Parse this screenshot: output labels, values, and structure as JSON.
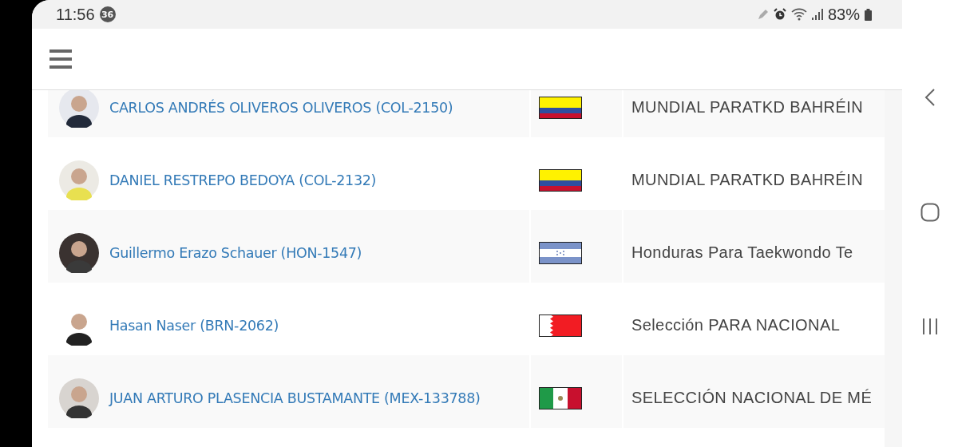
{
  "status_bar": {
    "time": "11:56",
    "notification_count": "36",
    "battery": "83%"
  },
  "athletes": [
    {
      "name": "CARLOS ANDRÉS OLIVEROS OLIVEROS (COL-2150)",
      "flag": {
        "kind": "colombia"
      },
      "team": "MUNDIAL PARATKD BAHRÉIN"
    },
    {
      "name": "DANIEL RESTREPO BEDOYA (COL-2132)",
      "flag": {
        "kind": "colombia"
      },
      "team": "MUNDIAL PARATKD BAHRÉIN"
    },
    {
      "name": "Guillermo Erazo Schauer (HON-1547)",
      "flag": {
        "kind": "honduras"
      },
      "team": "Honduras Para Taekwondo Te"
    },
    {
      "name": "Hasan Naser (BRN-2062)",
      "flag": {
        "kind": "bahrain"
      },
      "team": "Selección PARA NACIONAL"
    },
    {
      "name": "JUAN ARTURO PLASENCIA BUSTAMANTE (MEX-133788)",
      "flag": {
        "kind": "mexico"
      },
      "team": "SELECCIÓN NACIONAL DE MÉ"
    }
  ]
}
